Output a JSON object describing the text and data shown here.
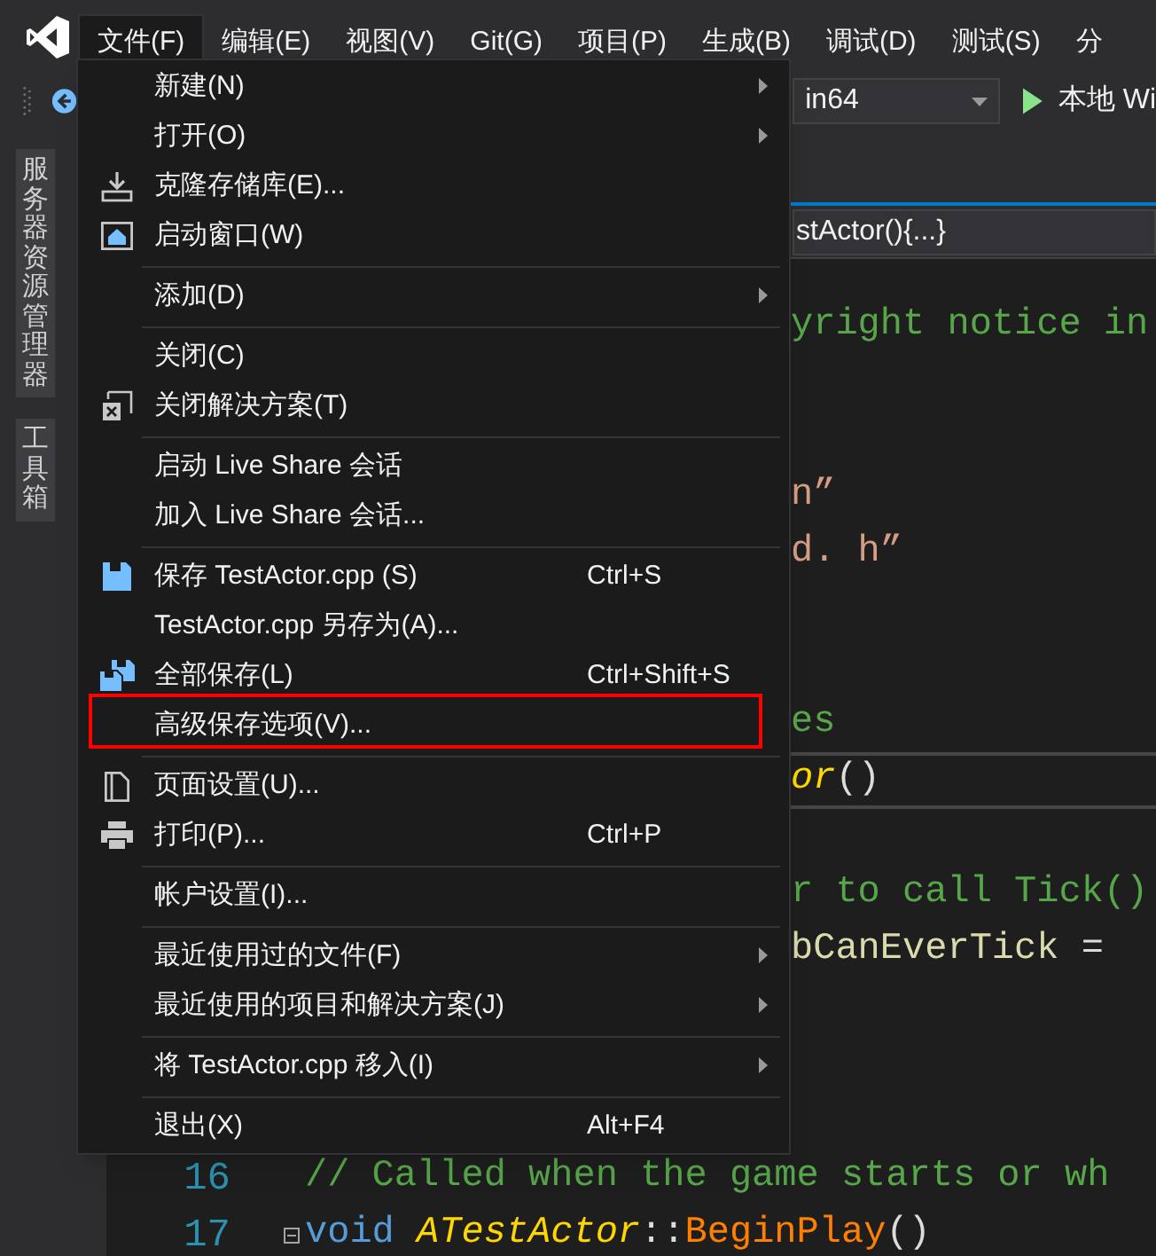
{
  "menu_bar": {
    "items": [
      {
        "label": "文件(F)",
        "selected": true
      },
      {
        "label": "编辑(E)",
        "selected": false
      },
      {
        "label": "视图(V)",
        "selected": false
      },
      {
        "label": "Git(G)",
        "selected": false
      },
      {
        "label": "项目(P)",
        "selected": false
      },
      {
        "label": "生成(B)",
        "selected": false
      },
      {
        "label": "调试(D)",
        "selected": false
      },
      {
        "label": "测试(S)",
        "selected": false
      },
      {
        "label": "分",
        "selected": false
      }
    ]
  },
  "toolbar": {
    "platform_dropdown": {
      "value": "in64"
    },
    "run_button": {
      "label": "本地 Wi"
    }
  },
  "side_tabs": [
    {
      "label": "服务器资源管理器"
    },
    {
      "label": "工具箱"
    }
  ],
  "navigation_bar": {
    "member_dropdown": {
      "value": "stActor(){...}"
    }
  },
  "editor": {
    "lines": [
      {
        "kind": "code",
        "current": false,
        "tokens": [
          {
            "kind": "comment",
            "text": "yright notice in"
          }
        ]
      },
      {
        "kind": "blank"
      },
      {
        "kind": "blank"
      },
      {
        "kind": "code",
        "current": false,
        "tokens": [
          {
            "kind": "string",
            "text": "n”"
          }
        ]
      },
      {
        "kind": "code",
        "current": false,
        "tokens": [
          {
            "kind": "string",
            "text": "d. h”"
          }
        ]
      },
      {
        "kind": "blank"
      },
      {
        "kind": "blank"
      },
      {
        "kind": "code",
        "current": false,
        "tokens": [
          {
            "kind": "comment",
            "text": "es"
          }
        ]
      },
      {
        "kind": "code",
        "current": true,
        "tokens": [
          {
            "kind": "type",
            "text": "or"
          },
          {
            "kind": "punct",
            "text": "()"
          }
        ]
      },
      {
        "kind": "blank"
      },
      {
        "kind": "code",
        "current": false,
        "tokens": [
          {
            "kind": "comment",
            "text": "r to call Tick()"
          }
        ]
      },
      {
        "kind": "code",
        "current": false,
        "tokens": [
          {
            "kind": "member",
            "text": "bCanEverTick"
          },
          {
            "kind": "punct",
            "text": " ="
          }
        ]
      },
      {
        "kind": "blank"
      },
      {
        "kind": "blank"
      },
      {
        "kind": "blank"
      },
      {
        "kind": "numbered",
        "current": false,
        "number": "16",
        "foldable": false,
        "tokens": [
          {
            "kind": "comment",
            "text": "// Called when the game starts or wh"
          }
        ]
      },
      {
        "kind": "numbered",
        "current": false,
        "number": "17",
        "foldable": true,
        "tokens": [
          {
            "kind": "keyword",
            "text": "void"
          },
          {
            "kind": "type",
            "text": "ATestActor"
          },
          {
            "kind": "punct",
            "text": "::"
          },
          {
            "kind": "function",
            "text": "BeginPlay"
          },
          {
            "kind": "punct",
            "text": "()"
          }
        ]
      }
    ]
  },
  "file_menu": {
    "items": [
      {
        "kind": "item",
        "label": "新建(N)",
        "submenu": true,
        "highlighted": false
      },
      {
        "kind": "item",
        "label": "打开(O)",
        "submenu": true,
        "highlighted": false
      },
      {
        "kind": "item",
        "label": "克隆存储库(E)...",
        "submenu": false,
        "highlighted": false
      },
      {
        "kind": "item",
        "label": "启动窗口(W)",
        "submenu": false,
        "highlighted": false
      },
      {
        "kind": "separator"
      },
      {
        "kind": "item",
        "label": "添加(D)",
        "submenu": true,
        "highlighted": false
      },
      {
        "kind": "separator"
      },
      {
        "kind": "item",
        "label": "关闭(C)",
        "submenu": false,
        "highlighted": false
      },
      {
        "kind": "item",
        "label": "关闭解决方案(T)",
        "submenu": false,
        "highlighted": false
      },
      {
        "kind": "separator"
      },
      {
        "kind": "item",
        "label": "启动 Live Share 会话",
        "submenu": false,
        "highlighted": false
      },
      {
        "kind": "item",
        "label": "加入 Live Share 会话...",
        "submenu": false,
        "highlighted": false
      },
      {
        "kind": "separator"
      },
      {
        "kind": "item",
        "label": "保存 TestActor.cpp (S)",
        "shortcut": "Ctrl+S",
        "submenu": false,
        "highlighted": false
      },
      {
        "kind": "item",
        "label": "TestActor.cpp 另存为(A)...",
        "submenu": false,
        "highlighted": false
      },
      {
        "kind": "item",
        "label": "全部保存(L)",
        "shortcut": "Ctrl+Shift+S",
        "submenu": false,
        "highlighted": false
      },
      {
        "kind": "item",
        "label": "高级保存选项(V)...",
        "submenu": false,
        "highlighted": true
      },
      {
        "kind": "separator"
      },
      {
        "kind": "item",
        "label": "页面设置(U)...",
        "submenu": false,
        "highlighted": false
      },
      {
        "kind": "item",
        "label": "打印(P)...",
        "shortcut": "Ctrl+P",
        "submenu": false,
        "highlighted": false
      },
      {
        "kind": "separator"
      },
      {
        "kind": "item",
        "label": "帐户设置(I)...",
        "submenu": false,
        "highlighted": false
      },
      {
        "kind": "separator"
      },
      {
        "kind": "item",
        "label": "最近使用过的文件(F)",
        "submenu": true,
        "highlighted": false
      },
      {
        "kind": "item",
        "label": "最近使用的项目和解决方案(J)",
        "submenu": true,
        "highlighted": false
      },
      {
        "kind": "separator"
      },
      {
        "kind": "item",
        "label": "将 TestActor.cpp 移入(I)",
        "submenu": true,
        "highlighted": false
      },
      {
        "kind": "separator"
      },
      {
        "kind": "item",
        "label": "退出(X)",
        "shortcut": "Alt+F4",
        "submenu": false,
        "highlighted": false
      }
    ]
  }
}
